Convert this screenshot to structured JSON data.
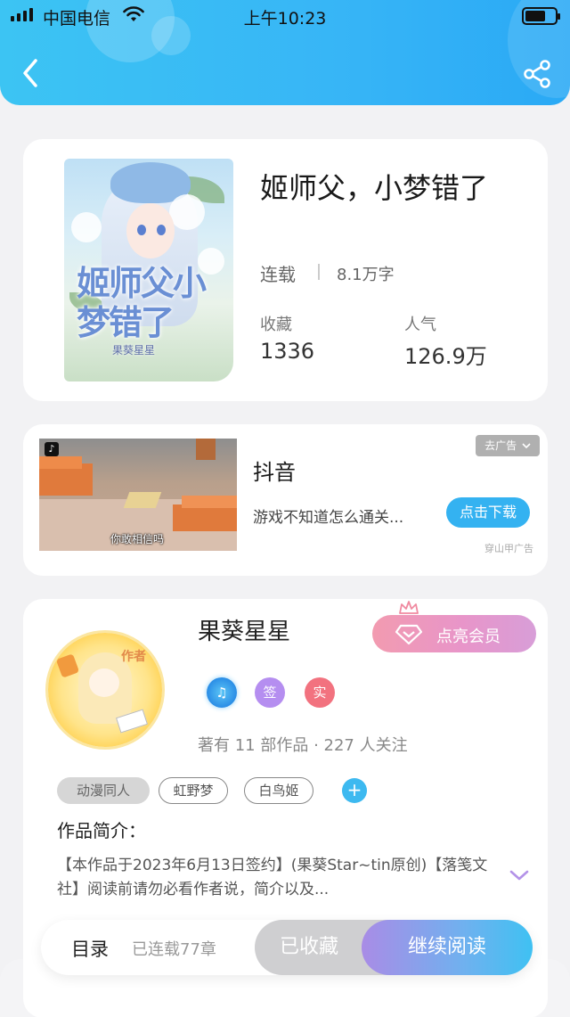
{
  "status_bar": {
    "carrier": "中国电信",
    "time": "上午10:23"
  },
  "book": {
    "title": "姬师父，小梦错了",
    "cover_title": "姬师父小梦错了",
    "cover_author": "果葵星星",
    "status": "连载",
    "words": "8.1万字",
    "collect_label": "收藏",
    "collect_value": "1336",
    "popularity_label": "人气",
    "popularity_value": "126.9万"
  },
  "ad": {
    "name": "抖音",
    "description": "游戏不知道怎么通关...",
    "download_label": "点击下载",
    "close_label": "去广告",
    "source": "穿山甲广告",
    "video_caption": "你敢相信吗"
  },
  "author": {
    "avatar_tag": "作者",
    "name": "果葵星星",
    "member_label": "点亮会员",
    "badges": {
      "sign": "签",
      "real": "实"
    },
    "stats": "著有 11 部作品 · 227 人关注",
    "tags": [
      "动漫同人",
      "虹野梦",
      "白鸟姬"
    ],
    "add_tag": "+",
    "intro_title": "作品简介：",
    "intro_text": "【本作品于2023年6月13日签约】(果葵Star~tin原创)【落笺文社】阅读前请勿必看作者说，简介以及..."
  },
  "bottom_bar": {
    "toc_label": "目录",
    "chapters": "已连载77章",
    "collected_label": "已收藏",
    "continue_label": "继续阅读"
  },
  "colors": {
    "header_blue": "#37b5f6",
    "accent_blue": "#34b2f1",
    "member_pink": "#f29bb0",
    "badge_purple": "#b58ef0",
    "badge_red": "#f2727f"
  },
  "icons": {
    "back": "chevron-left-icon",
    "share": "share-icon",
    "diamond": "diamond-icon",
    "crown": "crown-icon",
    "expand": "chevron-down-icon",
    "music_badge": "music-note-icon"
  }
}
